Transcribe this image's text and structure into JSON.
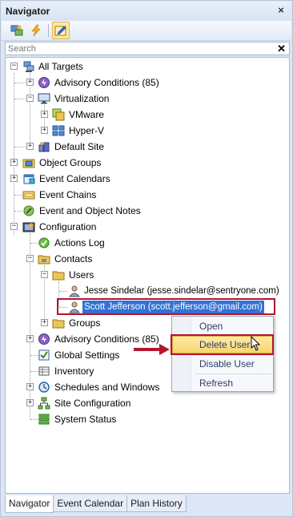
{
  "window": {
    "title": "Navigator",
    "close_glyph": "×"
  },
  "toolbar": {
    "icons": [
      "targets-icon",
      "lightning-icon",
      "edit-icon"
    ]
  },
  "search": {
    "placeholder": "Search",
    "clear_glyph": "✕"
  },
  "tree": {
    "items": [
      {
        "label": "All Targets",
        "icon": "all-targets-icon"
      },
      {
        "label": "Advisory Conditions (85)",
        "icon": "advisory-icon"
      },
      {
        "label": "Virtualization",
        "icon": "monitor-icon"
      },
      {
        "label": "VMware",
        "icon": "vmware-icon"
      },
      {
        "label": "Hyper-V",
        "icon": "hyperv-icon"
      },
      {
        "label": "Default Site",
        "icon": "site-icon"
      },
      {
        "label": "Object Groups",
        "icon": "object-groups-icon"
      },
      {
        "label": "Event Calendars",
        "icon": "calendar-icon"
      },
      {
        "label": "Event Chains",
        "icon": "event-chains-icon"
      },
      {
        "label": "Event and Object Notes",
        "icon": "notes-icon"
      },
      {
        "label": "Configuration",
        "icon": "configuration-icon"
      },
      {
        "label": "Actions Log",
        "icon": "actions-log-icon"
      },
      {
        "label": "Contacts",
        "icon": "folder-icon"
      },
      {
        "label": "Users",
        "icon": "folder-icon"
      },
      {
        "label": "Jesse Sindelar (jesse.sindelar@sentryone.com)",
        "icon": "user-icon"
      },
      {
        "label": "Scott Jefferson (scott.jefferson@gmail.com)",
        "icon": "user-icon"
      },
      {
        "label": "Groups",
        "icon": "folder-icon"
      },
      {
        "label": "Advisory Conditions (85)",
        "icon": "advisory-icon"
      },
      {
        "label": "Global Settings",
        "icon": "checkbox-icon"
      },
      {
        "label": "Inventory",
        "icon": "inventory-icon"
      },
      {
        "label": "Schedules and Windows",
        "icon": "schedule-icon"
      },
      {
        "label": "Site Configuration",
        "icon": "site-config-icon"
      },
      {
        "label": "System Status",
        "icon": "system-status-icon"
      }
    ]
  },
  "context_menu": {
    "items": [
      {
        "label": "Open"
      },
      {
        "label": "Delete User"
      },
      {
        "label": "Disable User"
      },
      {
        "label": "Refresh"
      }
    ]
  },
  "tabs": [
    {
      "label": "Navigator"
    },
    {
      "label": "Event Calendar"
    },
    {
      "label": "Plan History"
    }
  ],
  "colors": {
    "selection": "#3371d4",
    "highlight_outline": "#b3162e",
    "menu_highlight": "#f8d66e"
  }
}
